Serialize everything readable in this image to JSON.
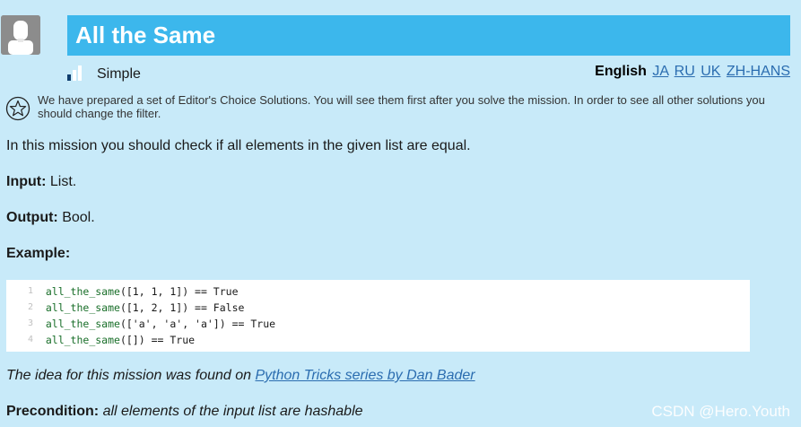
{
  "header": {
    "title": "All the Same",
    "difficulty_label": "Simple"
  },
  "languages": {
    "current": "English",
    "links": [
      "JA",
      "RU",
      "UK",
      "ZH-HANS"
    ]
  },
  "notice": "We have prepared a set of Editor's Choice Solutions. You will see them first after you solve the mission. In order to see all other solutions you should change the filter.",
  "description": "In this mission you should check if all elements in the given list are equal.",
  "input": {
    "label": "Input:",
    "value": "List."
  },
  "output": {
    "label": "Output:",
    "value": "Bool."
  },
  "example": {
    "label": "Example:"
  },
  "code_lines": [
    {
      "num": "1",
      "fn": "all_the_same",
      "rest": "([1, 1, 1]) == True"
    },
    {
      "num": "2",
      "fn": "all_the_same",
      "rest": "([1, 2, 1]) == False"
    },
    {
      "num": "3",
      "fn": "all_the_same",
      "rest": "(['a', 'a', 'a']) == True"
    },
    {
      "num": "4",
      "fn": "all_the_same",
      "rest": "([]) == True"
    }
  ],
  "idea": {
    "text": "The idea for this mission was found on ",
    "link_text": "Python Tricks series by Dan Bader"
  },
  "precondition": {
    "label": "Precondition:",
    "value": "all elements of the input list are hashable"
  },
  "watermark": "CSDN @Hero.Youth",
  "colors": {
    "title_bar": "#3cb7ec",
    "background": "#c8eaf9",
    "link": "#2b6db0",
    "difficulty_active": "#0f3d6e",
    "difficulty_inactive": "#ffffff"
  }
}
